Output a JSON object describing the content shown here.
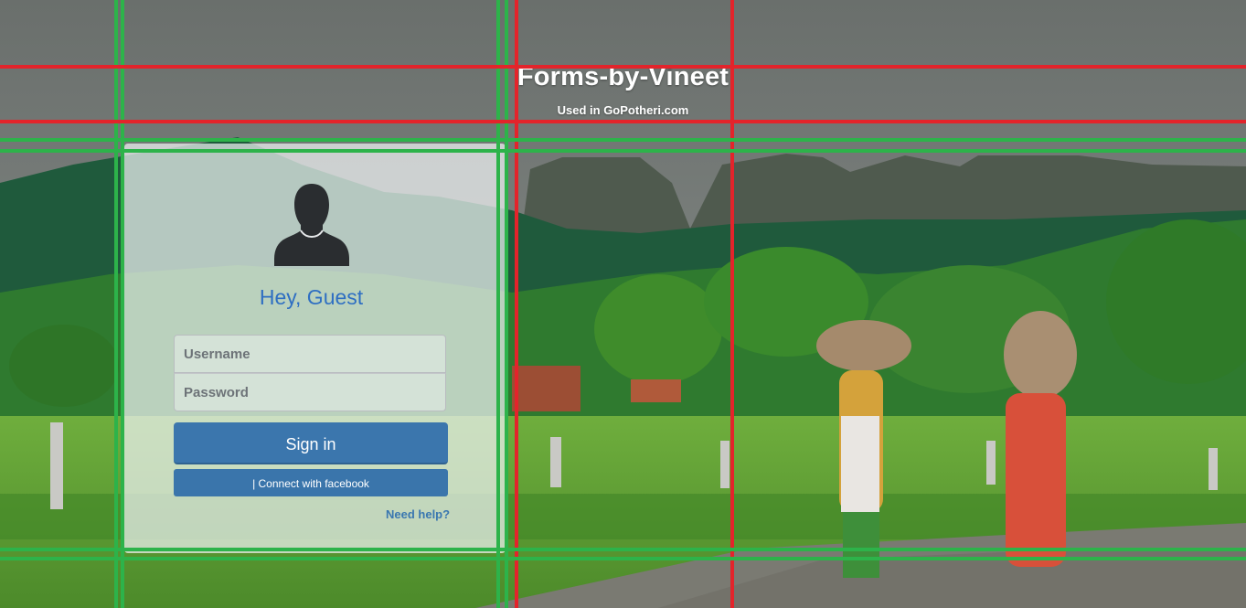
{
  "header": {
    "title": "Forms-by-Vineet",
    "subtitle": "Used in GoPotheri.com"
  },
  "login": {
    "greeting": "Hey, Guest",
    "avatar_icon": "user-silhouette-icon",
    "username_placeholder": "Username",
    "password_placeholder": "Password",
    "signin_label": "Sign in",
    "facebook_label": "| Connect with facebook",
    "help_label": "Need help?"
  },
  "colors": {
    "greeting": "#2f6fc2",
    "button": "#3b76ad",
    "link": "#3a77b0",
    "guide_green": "#2db34a",
    "guide_red": "#e3242b"
  }
}
